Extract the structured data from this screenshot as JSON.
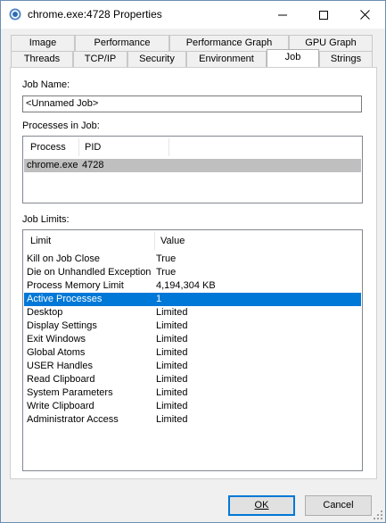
{
  "window": {
    "title": "chrome.exe:4728 Properties",
    "icon": "chrome-icon",
    "accent_border": "#6d8fb3"
  },
  "tabs": {
    "row1": [
      "Image",
      "Performance",
      "Performance Graph",
      "GPU Graph"
    ],
    "row2": [
      "Threads",
      "TCP/IP",
      "Security",
      "Environment",
      "Job",
      "Strings"
    ],
    "active": "Job"
  },
  "job": {
    "name_label": "Job Name:",
    "name_value": "<Unnamed Job>",
    "processes_label": "Processes in Job:",
    "processes_columns": [
      "Process",
      "PID"
    ],
    "processes": [
      {
        "process": "chrome.exe",
        "pid": "4728"
      }
    ],
    "limits_label": "Job Limits:",
    "limits_columns": [
      "Limit",
      "Value"
    ],
    "limits": [
      {
        "limit": "Kill on Job Close",
        "value": "True"
      },
      {
        "limit": "Die on Unhandled Exception",
        "value": "True"
      },
      {
        "limit": "Process Memory Limit",
        "value": "4,194,304 KB"
      },
      {
        "limit": "Active Processes",
        "value": "1"
      },
      {
        "limit": "Desktop",
        "value": "Limited"
      },
      {
        "limit": "Display Settings",
        "value": "Limited"
      },
      {
        "limit": "Exit Windows",
        "value": "Limited"
      },
      {
        "limit": "Global Atoms",
        "value": "Limited"
      },
      {
        "limit": "USER Handles",
        "value": "Limited"
      },
      {
        "limit": "Read Clipboard",
        "value": "Limited"
      },
      {
        "limit": "System Parameters",
        "value": "Limited"
      },
      {
        "limit": "Write Clipboard",
        "value": "Limited"
      },
      {
        "limit": "Administrator Access",
        "value": "Limited"
      }
    ],
    "selected_limit": "Active Processes",
    "selection_color": "#0078d7",
    "inactive_selection_color": "#bfbfbf"
  },
  "buttons": {
    "ok": "OK",
    "cancel": "Cancel"
  }
}
